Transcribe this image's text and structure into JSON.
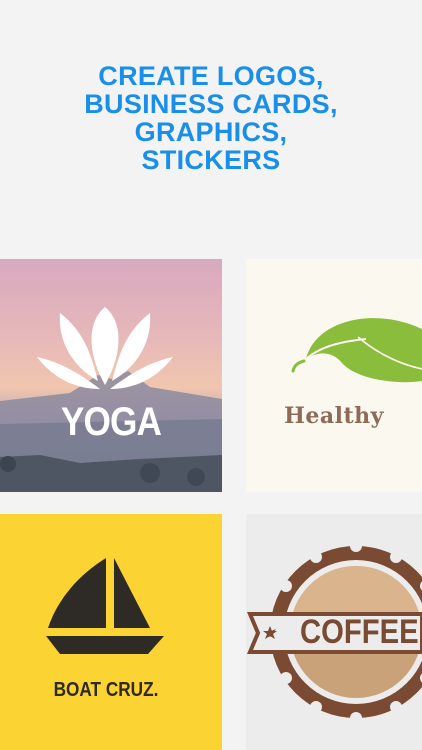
{
  "headline": {
    "lines": [
      "CREATE LOGOS,",
      "BUSINESS CARDS,",
      "GRAPHICS,",
      "STICKERS"
    ]
  },
  "tiles": [
    {
      "name": "yoga",
      "logo_text": "YOGA",
      "icon": "lotus-icon"
    },
    {
      "name": "healthy",
      "logo_text": "Healthy",
      "icon": "leaf-icon"
    },
    {
      "name": "boat",
      "logo_text": "BOAT CRUZ.",
      "icon": "sailboat-icon"
    },
    {
      "name": "coffee",
      "logo_text": "COFFEE",
      "icon": "coffee-badge-icon"
    }
  ],
  "colors": {
    "headline": "#1a8fe9",
    "background": "#f3f3f3",
    "boat_tile": "#fbd332",
    "healthy_tile": "#fbf8ef",
    "leaf": "#8bbd3c",
    "coffee_brown": "#7a4a33"
  }
}
